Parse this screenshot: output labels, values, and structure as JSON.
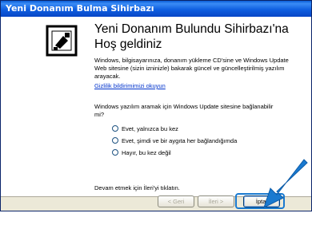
{
  "window": {
    "title": "Yeni Donanım Bulma Sihirbazı"
  },
  "content": {
    "heading": "Yeni Donanım Bulundu Sihirbazı'na Hoş geldiniz",
    "intro": "Windows, bilgisayarınıza, donanım yükleme CD'sine ve Windows Update Web sitesine (sizin izninizle) bakarak güncel ve güncelleştirilmiş yazılım arayacak.",
    "privacy_link": "Gizlilik bildirimimizi okuyun",
    "question": "Windows yazılım aramak için Windows Update sitesine bağlanabilir mi?",
    "options": [
      "Evet, yalnızca bu kez",
      "Evet, şimdi ve bir aygıta her bağlandığımda",
      "Hayır, bu kez değil"
    ],
    "continue_text": "Devam etmek için İleri'yi tıklatın."
  },
  "buttons": {
    "back": "< Geri",
    "next": "İleri >",
    "cancel": "İptal"
  },
  "colors": {
    "titlebar": "#0f5fe0",
    "highlight_arrow": "#1a7ad0"
  }
}
